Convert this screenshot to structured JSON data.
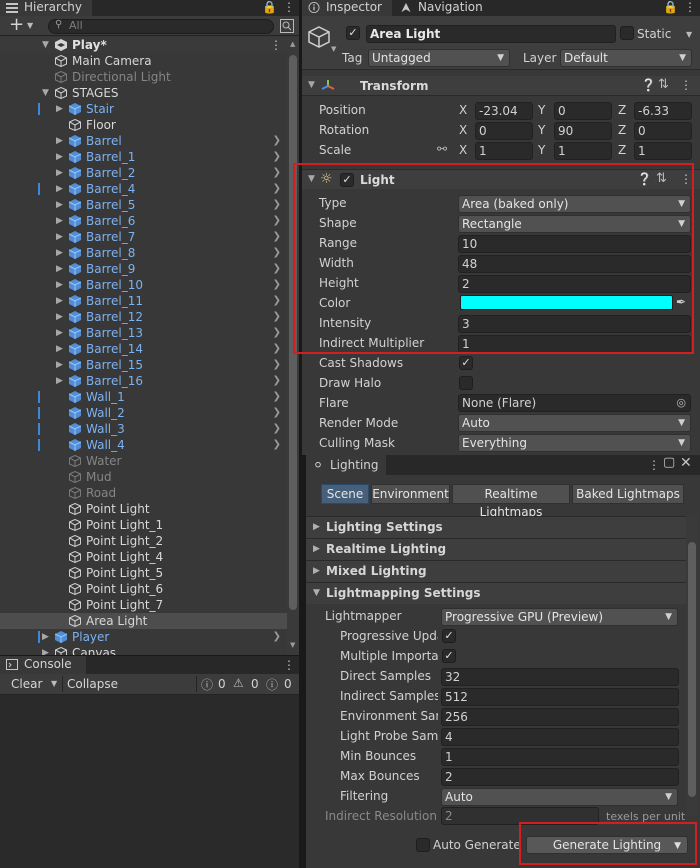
{
  "hierarchy": {
    "tab": "Hierarchy",
    "search_placeholder": "All",
    "add_label": "+",
    "scene": "Play*",
    "items": [
      {
        "name": "Main Camera",
        "style": "white"
      },
      {
        "name": "Directional Light",
        "style": "gray"
      },
      {
        "name": "STAGES",
        "style": "white"
      },
      {
        "name": "Stair",
        "style": "blue"
      },
      {
        "name": "Floor",
        "style": "white"
      },
      {
        "name": "Barrel",
        "style": "blue"
      },
      {
        "name": "Barrel_1",
        "style": "blue"
      },
      {
        "name": "Barrel_2",
        "style": "blue"
      },
      {
        "name": "Barrel_4",
        "style": "blue"
      },
      {
        "name": "Barrel_5",
        "style": "blue"
      },
      {
        "name": "Barrel_6",
        "style": "blue"
      },
      {
        "name": "Barrel_7",
        "style": "blue"
      },
      {
        "name": "Barrel_8",
        "style": "blue"
      },
      {
        "name": "Barrel_9",
        "style": "blue"
      },
      {
        "name": "Barrel_10",
        "style": "blue"
      },
      {
        "name": "Barrel_11",
        "style": "blue"
      },
      {
        "name": "Barrel_12",
        "style": "blue"
      },
      {
        "name": "Barrel_13",
        "style": "blue"
      },
      {
        "name": "Barrel_14",
        "style": "blue"
      },
      {
        "name": "Barrel_15",
        "style": "blue"
      },
      {
        "name": "Barrel_16",
        "style": "blue"
      },
      {
        "name": "Wall_1",
        "style": "blue"
      },
      {
        "name": "Wall_2",
        "style": "blue"
      },
      {
        "name": "Wall_3",
        "style": "blue"
      },
      {
        "name": "Wall_4",
        "style": "blue"
      },
      {
        "name": "Water",
        "style": "gray"
      },
      {
        "name": "Mud",
        "style": "gray"
      },
      {
        "name": "Road",
        "style": "gray"
      },
      {
        "name": "Point Light",
        "style": "white"
      },
      {
        "name": "Point Light_1",
        "style": "white"
      },
      {
        "name": "Point Light_2",
        "style": "white"
      },
      {
        "name": "Point Light_4",
        "style": "white"
      },
      {
        "name": "Point Light_5",
        "style": "white"
      },
      {
        "name": "Point Light_6",
        "style": "white"
      },
      {
        "name": "Point Light_7",
        "style": "white"
      },
      {
        "name": "Area Light",
        "style": "white"
      },
      {
        "name": "Player",
        "style": "blue"
      },
      {
        "name": "Canvas",
        "style": "white"
      }
    ]
  },
  "console": {
    "tab": "Console",
    "clear_label": "Clear",
    "collapse_label": "Collapse",
    "info_count": "0",
    "warn_count": "0",
    "error_count": "0"
  },
  "inspector": {
    "tab": "Inspector",
    "nav_tab": "Navigation",
    "object_name": "Area Light",
    "static_label": "Static",
    "tag_label": "Tag",
    "tag_value": "Untagged",
    "layer_label": "Layer",
    "layer_value": "Default",
    "transform": {
      "title": "Transform",
      "position_label": "Position",
      "rotation_label": "Rotation",
      "scale_label": "Scale",
      "axis_x": "X",
      "axis_y": "Y",
      "axis_z": "Z",
      "position": {
        "x": "-23.04",
        "y": "0",
        "z": "-6.33"
      },
      "rotation": {
        "x": "0",
        "y": "90",
        "z": "0"
      },
      "scale": {
        "x": "1",
        "y": "1",
        "z": "1"
      }
    },
    "light": {
      "title": "Light",
      "type_label": "Type",
      "type_value": "Area (baked only)",
      "shape_label": "Shape",
      "shape_value": "Rectangle",
      "range_label": "Range",
      "range_value": "10",
      "width_label": "Width",
      "width_value": "48",
      "height_label": "Height",
      "height_value": "2",
      "color_label": "Color",
      "color_value": "#00ffff",
      "intensity_label": "Intensity",
      "intensity_value": "3",
      "indirect_label": "Indirect Multiplier",
      "indirect_value": "1",
      "cast_shadows_label": "Cast Shadows",
      "draw_halo_label": "Draw Halo",
      "flare_label": "Flare",
      "flare_value": "None (Flare)",
      "render_mode_label": "Render Mode",
      "render_mode_value": "Auto",
      "culling_label": "Culling Mask",
      "culling_value": "Everything"
    }
  },
  "lighting": {
    "tab": "Lighting",
    "tabs": [
      "Scene",
      "Environment",
      "Realtime Lightmaps",
      "Baked Lightmaps"
    ],
    "sections": [
      "Lighting Settings",
      "Realtime Lighting",
      "Mixed Lighting",
      "Lightmapping Settings"
    ],
    "lightmapper_label": "Lightmapper",
    "lightmapper_value": "Progressive GPU (Preview)",
    "progressive_label": "Progressive Upda",
    "multiple_label": "Multiple Importanc",
    "direct_label": "Direct Samples",
    "direct_value": "32",
    "indirect_label": "Indirect Samples",
    "indirect_value": "512",
    "env_label": "Environment Sam",
    "env_value": "256",
    "probe_label": "Light Probe Samp",
    "probe_value": "4",
    "min_label": "Min Bounces",
    "min_value": "1",
    "max_label": "Max Bounces",
    "max_value": "2",
    "filter_label": "Filtering",
    "filter_value": "Auto",
    "res_label": "Indirect Resolution",
    "res_value": "2",
    "res_unit": "texels per unit",
    "auto_generate_label": "Auto Generate",
    "generate_label": "Generate Lighting"
  },
  "colors": {
    "accent": "#d21f1f",
    "prefab": "#7bb2f2",
    "selection": "#4d4d4d"
  }
}
